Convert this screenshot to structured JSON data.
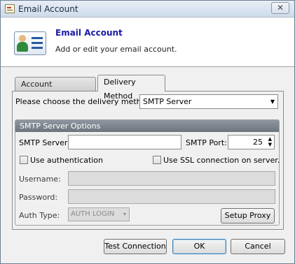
{
  "window": {
    "title": "Email Account",
    "close_glyph": "✕"
  },
  "header": {
    "title": "Email Account",
    "subtitle": "Add or edit your email account.",
    "icon": "address-card-icon"
  },
  "tabs": [
    {
      "label": "Account Information",
      "active": false
    },
    {
      "label": "Delivery Method",
      "active": true
    }
  ],
  "delivery": {
    "label": "Please choose the delivery method:",
    "selected": "SMTP Server"
  },
  "smtp": {
    "group_title": "SMTP Server Options",
    "server_label": "SMTP Server:",
    "server_value": "",
    "port_label": "SMTP Port:",
    "port_value": "25",
    "use_auth_label": "Use authentication",
    "use_auth_checked": false,
    "use_ssl_label": "Use SSL connection on server.",
    "use_ssl_checked": false,
    "username_label": "Username:",
    "username_value": "",
    "password_label": "Password:",
    "password_value": "",
    "auth_type_label": "Auth Type:",
    "auth_type_value": "AUTH LOGIN",
    "setup_proxy_label": "Setup Proxy"
  },
  "buttons": {
    "test_connection": "Test Connection",
    "ok": "OK",
    "cancel": "Cancel"
  }
}
